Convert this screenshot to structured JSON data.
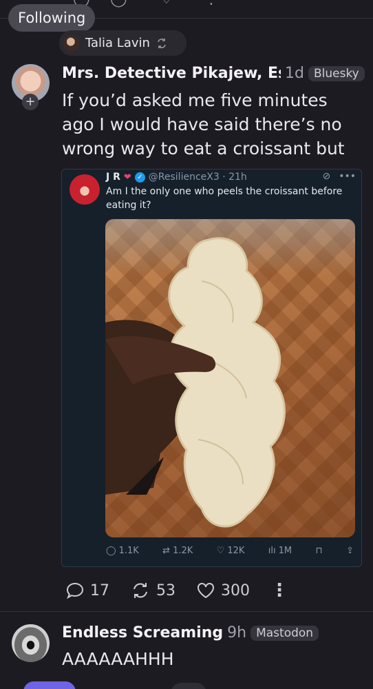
{
  "header": {
    "filter_label": "Following"
  },
  "repost": {
    "reposter_name": "Talia Lavin",
    "repost_icon": "repost-icon"
  },
  "post": {
    "author_name": "Mrs. Detective Pikajew, Es",
    "timestamp": "1d",
    "source": "Bluesky",
    "text": "If you’d asked me five minutes ago I would have said there’s no wrong way to eat a croissant but",
    "embed": {
      "name": "J R",
      "handle": "@ResilienceX3 · 21h",
      "text": "Am I the only one who peels the croissant before eating it?",
      "replies": "1.1K",
      "reposts": "1.2K",
      "likes": "12K",
      "views": "1M",
      "icons": [
        "heart-badge-icon",
        "verified-icon",
        "grok-icon",
        "more-icon",
        "reply-icon",
        "retweet-icon",
        "like-icon",
        "views-icon",
        "bookmark-icon",
        "share-icon"
      ]
    },
    "actions": {
      "replies": "17",
      "reposts": "53",
      "likes": "300"
    }
  },
  "next_post": {
    "author_name": "Endless Screaming",
    "timestamp": "9h",
    "source": "Mastodon",
    "text": "AAAAAAHHH"
  },
  "colors": {
    "background": "#1d1b22",
    "embed_background": "#15202b",
    "accent": "#6f63e6"
  }
}
